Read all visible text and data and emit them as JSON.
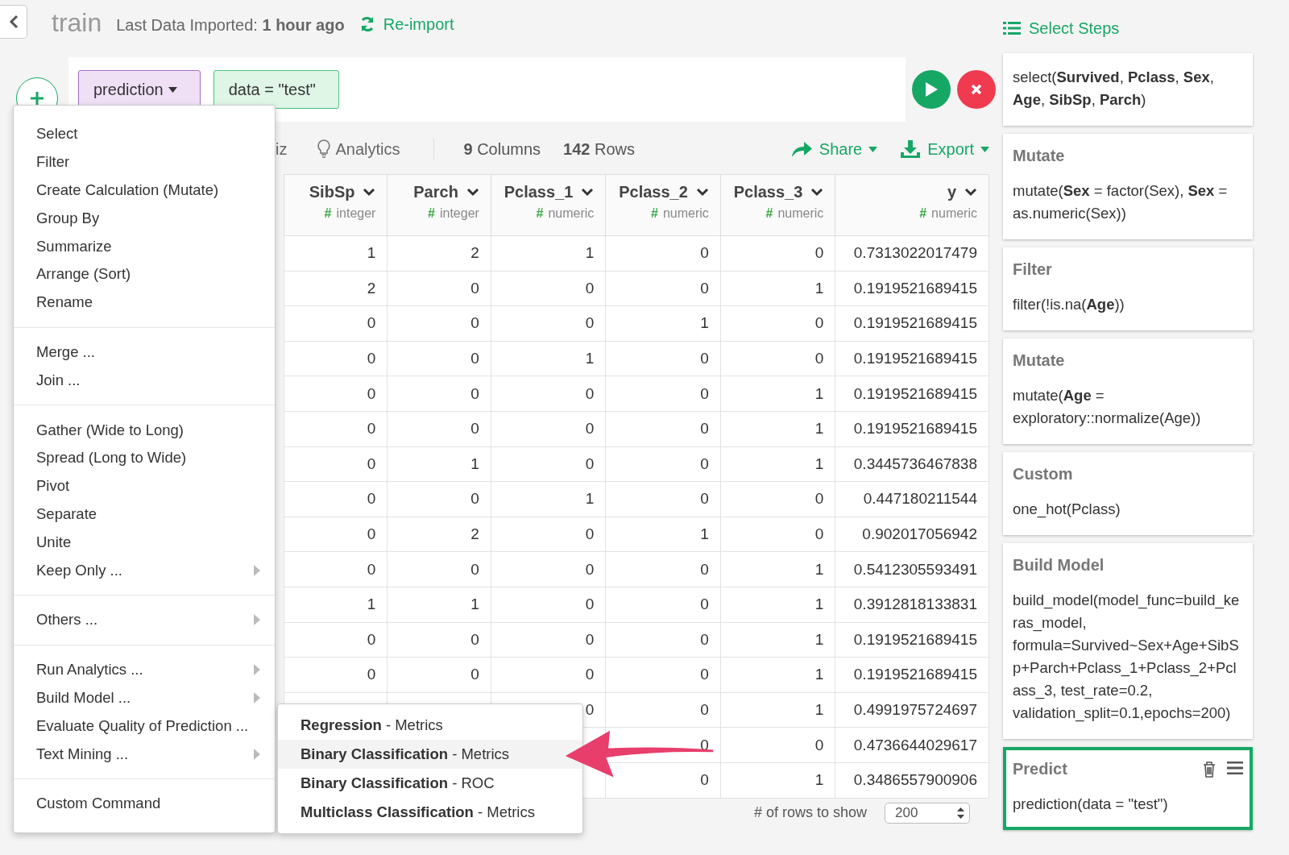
{
  "header": {
    "title": "train",
    "import_info": "Last Data Imported: **1 hour ago**",
    "reimport": "Re-import"
  },
  "command_bar": {
    "tokens": [
      {
        "kind": "function",
        "label": "prediction"
      },
      {
        "kind": "argument",
        "label": "data = \"test\""
      }
    ]
  },
  "toolbar": {
    "viz_tab": "iz",
    "analytics_tab": "Analytics",
    "columns": "**9** Columns",
    "rows": "**142** Rows",
    "share": "Share",
    "export": "Export"
  },
  "table": {
    "columns": [
      {
        "name": "SibSp",
        "type_icon": "#",
        "type": "integer"
      },
      {
        "name": "Parch",
        "type_icon": "#",
        "type": "integer"
      },
      {
        "name": "Pclass_1",
        "type_icon": "#",
        "type": "numeric"
      },
      {
        "name": "Pclass_2",
        "type_icon": "#",
        "type": "numeric"
      },
      {
        "name": "Pclass_3",
        "type_icon": "#",
        "type": "numeric"
      },
      {
        "name": "y",
        "type_icon": "#",
        "type": "numeric"
      }
    ],
    "rows": [
      [
        "1",
        "2",
        "1",
        "0",
        "0",
        "0.7313022017479"
      ],
      [
        "2",
        "0",
        "0",
        "0",
        "1",
        "0.1919521689415"
      ],
      [
        "0",
        "0",
        "0",
        "1",
        "0",
        "0.1919521689415"
      ],
      [
        "0",
        "0",
        "1",
        "0",
        "0",
        "0.1919521689415"
      ],
      [
        "0",
        "0",
        "0",
        "0",
        "1",
        "0.1919521689415"
      ],
      [
        "0",
        "0",
        "0",
        "0",
        "1",
        "0.1919521689415"
      ],
      [
        "0",
        "1",
        "0",
        "0",
        "1",
        "0.3445736467838"
      ],
      [
        "0",
        "0",
        "1",
        "0",
        "0",
        "0.447180211544"
      ],
      [
        "0",
        "2",
        "0",
        "1",
        "0",
        "0.902017056942"
      ],
      [
        "0",
        "0",
        "0",
        "0",
        "1",
        "0.5412305593491"
      ],
      [
        "1",
        "1",
        "0",
        "0",
        "1",
        "0.3912818133831"
      ],
      [
        "0",
        "0",
        "0",
        "0",
        "1",
        "0.1919521689415"
      ],
      [
        "0",
        "0",
        "0",
        "0",
        "1",
        "0.1919521689415"
      ],
      [
        null,
        null,
        "0",
        "0",
        "1",
        "0.4991975724697"
      ],
      [
        null,
        null,
        null,
        "0",
        "0",
        "0.4736644029617"
      ],
      [
        null,
        null,
        null,
        "0",
        "1",
        "0.3486557900906"
      ]
    ]
  },
  "footer": {
    "rows_label": "# of rows to show",
    "rows_value": "200"
  },
  "steps_panel": {
    "title": "Select Steps",
    "steps": [
      {
        "body": "select(**Survived**, **Pclass**, **Sex**, **Age**, **SibSp**, **Parch**)",
        "selected": false
      },
      {
        "title": "Mutate",
        "body": "mutate(**Sex** = factor(Sex), **Sex** = as.numeric(Sex))",
        "selected": false
      },
      {
        "title": "Filter",
        "body": "filter(!is.na(**Age**))",
        "selected": false
      },
      {
        "title": "Mutate",
        "body": "mutate(**Age** = exploratory::normalize(Age))",
        "selected": false
      },
      {
        "title": "Custom",
        "body": "one_hot(Pclass)",
        "selected": false
      },
      {
        "title": "Build Model",
        "body": "build_model(model_func=build_keras_model, formula=Survived~Sex+Age+SibSp+Parch+Pclass_1+Pclass_2+Pclass_3, test_rate=0.2, validation_split=0.1,epochs=200)",
        "selected": false
      },
      {
        "title": "Predict",
        "body": "prediction(data = \"test\")",
        "selected": true
      }
    ]
  },
  "add_menu": {
    "groups": [
      [
        {
          "label": "Select",
          "submenu": false
        },
        {
          "label": "Filter",
          "submenu": false
        },
        {
          "label": "Create Calculation (Mutate)",
          "submenu": false
        },
        {
          "label": "Group By",
          "submenu": false
        },
        {
          "label": "Summarize",
          "submenu": false
        },
        {
          "label": "Arrange (Sort)",
          "submenu": false
        },
        {
          "label": "Rename",
          "submenu": false
        }
      ],
      [
        {
          "label": "Merge ...",
          "submenu": false
        },
        {
          "label": "Join ...",
          "submenu": false
        }
      ],
      [
        {
          "label": "Gather (Wide to Long)",
          "submenu": false
        },
        {
          "label": "Spread (Long to Wide)",
          "submenu": false
        },
        {
          "label": "Pivot",
          "submenu": false
        },
        {
          "label": "Separate",
          "submenu": false
        },
        {
          "label": "Unite",
          "submenu": false
        },
        {
          "label": "Keep Only ...",
          "submenu": true
        }
      ],
      [
        {
          "label": "Others ...",
          "submenu": true
        }
      ],
      [
        {
          "label": "Run Analytics ...",
          "submenu": true
        },
        {
          "label": "Build Model ...",
          "submenu": true
        },
        {
          "label": "Evaluate Quality of Prediction ...",
          "submenu": false
        },
        {
          "label": "Text Mining ...",
          "submenu": true
        }
      ],
      [
        {
          "label": "Custom Command",
          "submenu": false
        }
      ]
    ]
  },
  "evaluate_submenu": {
    "items": [
      {
        "label": "**Regression** - Metrics",
        "selected": false
      },
      {
        "label": "**Binary Classification** - Metrics",
        "selected": true
      },
      {
        "label": "**Binary Classification** - ROC",
        "selected": false
      },
      {
        "label": "**Multiclass Classification** - Metrics",
        "selected": false
      }
    ]
  }
}
